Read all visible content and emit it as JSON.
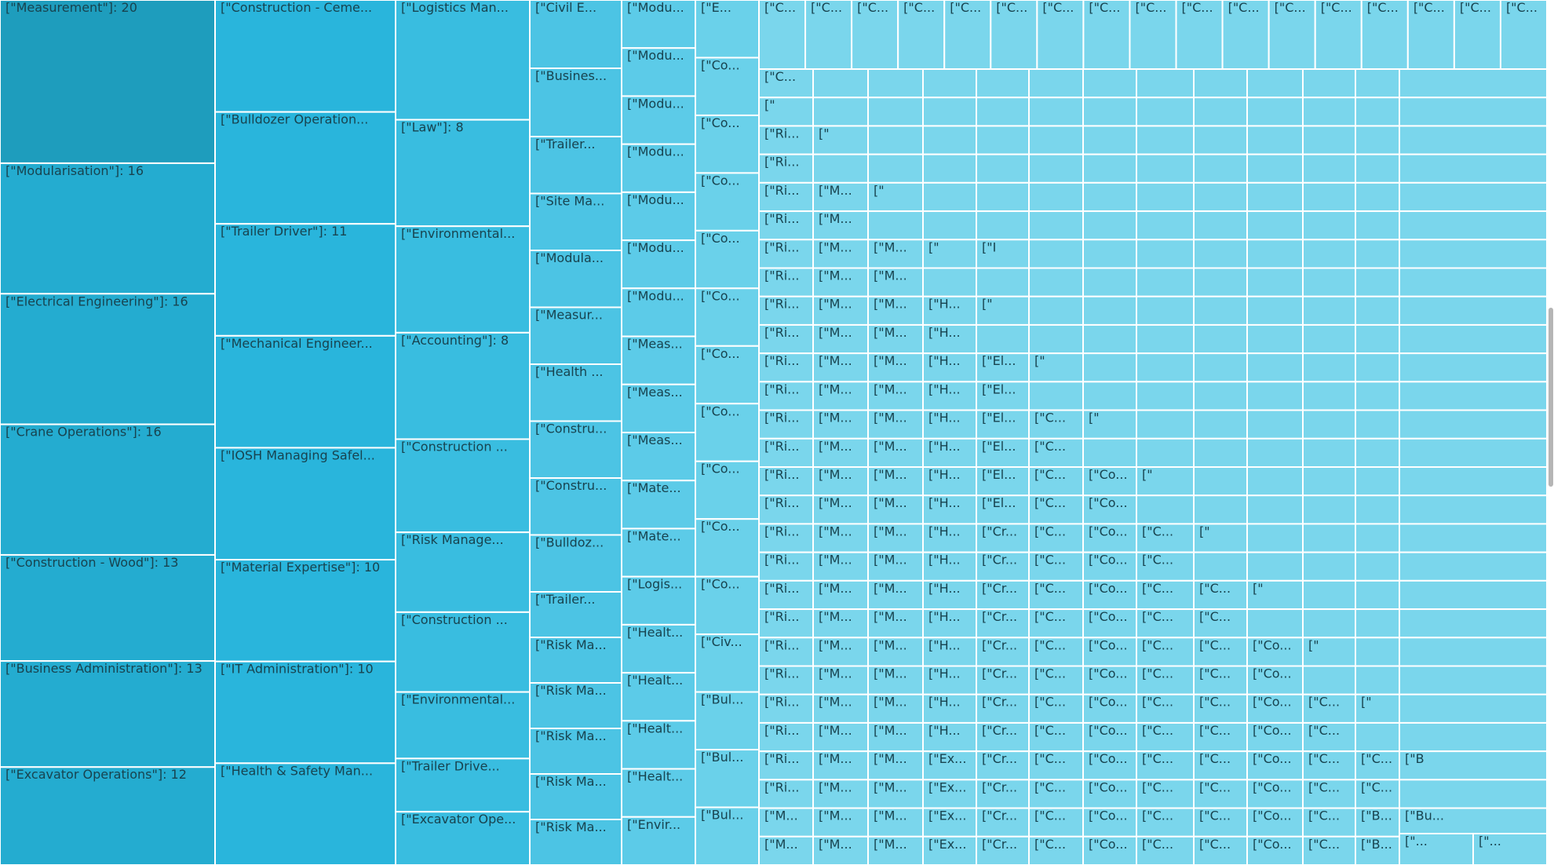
{
  "chart_data": {
    "type": "treemap",
    "colors": {
      "measurement": "#1e9dbd",
      "column0": "#24acd0",
      "column1": "#29b5dc",
      "column2": "#39bde0",
      "column3": "#4cc4e4",
      "column4": "#5ccbe8",
      "column5": "#6ad1ea",
      "rest": "#7ad6ec",
      "border": "#ffffff",
      "label": "#18434f"
    },
    "columns": [
      {
        "items": [
          {
            "label": "[\"Measurement\"]: 20",
            "value": 20
          },
          {
            "label": "[\"Modularisation\"]: 16",
            "value": 16
          },
          {
            "label": "[\"Electrical Engineering\"]: 16",
            "value": 16
          },
          {
            "label": "[\"Crane Operations\"]: 16",
            "value": 16
          },
          {
            "label": "[\"Construction - Wood\"]: 13",
            "value": 13
          },
          {
            "label": "[\"Business Administration\"]: 13",
            "value": 13
          },
          {
            "label": "[\"Excavator Operations\"]: 12",
            "value": 12
          }
        ]
      },
      {
        "items": [
          {
            "label": "[\"Construction - Ceme...",
            "value": 11
          },
          {
            "label": "[\"Bulldozer Operation...",
            "value": 11
          },
          {
            "label": "[\"Trailer Driver\"]: 11",
            "value": 11
          },
          {
            "label": "[\"Mechanical Engineer...",
            "value": 11
          },
          {
            "label": "[\"IOSH Managing Safel...",
            "value": 11
          },
          {
            "label": "[\"Material Expertise\"]: 10",
            "value": 10
          },
          {
            "label": "[\"IT Administration\"]: 10",
            "value": 10
          },
          {
            "label": "[\"Health & Safety Man...",
            "value": 10
          }
        ]
      },
      {
        "items": [
          {
            "label": "[\"Logistics Man...",
            "value": 9
          },
          {
            "label": "[\"Law\"]: 8",
            "value": 8
          },
          {
            "label": "[\"Environmental...",
            "value": 8
          },
          {
            "label": "[\"Accounting\"]: 8",
            "value": 8
          },
          {
            "label": "[\"Construction ...",
            "value": 7
          },
          {
            "label": "[\"Risk Manage...",
            "value": 6
          },
          {
            "label": "[\"Construction ...",
            "value": 6
          },
          {
            "label": "[\"Environmental...",
            "value": 5
          },
          {
            "label": "[\"Trailer Drive...",
            "value": 4
          },
          {
            "label": "[\"Excavator Ope...",
            "value": 4
          }
        ]
      },
      {
        "items": [
          {
            "label": "[\"Civil E...",
            "value": 6
          },
          {
            "label": "[\"Busines...",
            "value": 6
          },
          {
            "label": "[\"Trailer...",
            "value": 5
          },
          {
            "label": "[\"Site Ma...",
            "value": 5
          },
          {
            "label": "[\"Modula...",
            "value": 5
          },
          {
            "label": "[\"Measur...",
            "value": 5
          },
          {
            "label": "[\"Health ...",
            "value": 5
          },
          {
            "label": "[\"Constru...",
            "value": 5
          },
          {
            "label": "[\"Constru...",
            "value": 5
          },
          {
            "label": "[\"Bulldoz...",
            "value": 5
          },
          {
            "label": "[\"Trailer...",
            "value": 4
          },
          {
            "label": "[\"Risk Ma...",
            "value": 4
          },
          {
            "label": "[\"Risk Ma...",
            "value": 4
          },
          {
            "label": "[\"Risk Ma...",
            "value": 4
          },
          {
            "label": "[\"Risk Ma...",
            "value": 4
          },
          {
            "label": "[\"Risk Ma...",
            "value": 4
          }
        ]
      },
      {
        "items": [
          {
            "label": "[\"Modu...",
            "value": 4
          },
          {
            "label": "[\"Modu...",
            "value": 4
          },
          {
            "label": "[\"Modu...",
            "value": 4
          },
          {
            "label": "[\"Modu...",
            "value": 4
          },
          {
            "label": "[\"Modu...",
            "value": 4
          },
          {
            "label": "[\"Modu...",
            "value": 4
          },
          {
            "label": "[\"Modu...",
            "value": 4
          },
          {
            "label": "[\"Meas...",
            "value": 4
          },
          {
            "label": "[\"Meas...",
            "value": 4
          },
          {
            "label": "[\"Meas...",
            "value": 4
          },
          {
            "label": "[\"Mate...",
            "value": 4
          },
          {
            "label": "[\"Mate...",
            "value": 4
          },
          {
            "label": "[\"Logis...",
            "value": 4
          },
          {
            "label": "[\"Healt...",
            "value": 4
          },
          {
            "label": "[\"Healt...",
            "value": 4
          },
          {
            "label": "[\"Healt...",
            "value": 4
          },
          {
            "label": "[\"Healt...",
            "value": 4
          },
          {
            "label": "[\"Envir...",
            "value": 4
          }
        ]
      },
      {
        "items": [
          {
            "label": "[\"E...",
            "value": 3
          },
          {
            "label": "[\"Co...",
            "value": 3
          },
          {
            "label": "[\"Co...",
            "value": 3
          },
          {
            "label": "[\"Co...",
            "value": 3
          },
          {
            "label": "[\"Co...",
            "value": 3
          },
          {
            "label": "[\"Co...",
            "value": 3
          },
          {
            "label": "[\"Co...",
            "value": 3
          },
          {
            "label": "[\"Co...",
            "value": 3
          },
          {
            "label": "[\"Co...",
            "value": 3
          },
          {
            "label": "[\"Co...",
            "value": 3
          },
          {
            "label": "[\"Co...",
            "value": 3
          },
          {
            "label": "[\"Civ...",
            "value": 3
          },
          {
            "label": "[\"Bul...",
            "value": 3
          },
          {
            "label": "[\"Bul...",
            "value": 3
          },
          {
            "label": "[\"Bul...",
            "value": 3
          }
        ]
      }
    ],
    "rest_grid": {
      "rows": [
        {
          "texts": [
            "[\"C..."
          ]
        },
        {
          "texts": [
            "[\""
          ]
        },
        {
          "texts": [
            "[\"Ri...",
            "[\""
          ]
        },
        {
          "texts": [
            "[\"Ri..."
          ]
        },
        {
          "texts": [
            "[\"Ri...",
            "[\"M...",
            "[\""
          ]
        },
        {
          "texts": [
            "[\"Ri...",
            "[\"M..."
          ]
        },
        {
          "texts": [
            "[\"Ri...",
            "[\"M...",
            "[\"M...",
            "[\"",
            "[\"I"
          ]
        },
        {
          "texts": [
            "[\"Ri...",
            "[\"M...",
            "[\"M..."
          ]
        },
        {
          "texts": [
            "[\"Ri...",
            "[\"M...",
            "[\"M...",
            "[\"H...",
            "[\""
          ]
        },
        {
          "texts": [
            "[\"Ri...",
            "[\"M...",
            "[\"M...",
            "[\"H..."
          ]
        },
        {
          "texts": [
            "[\"Ri...",
            "[\"M...",
            "[\"M...",
            "[\"H...",
            "[\"El...",
            "[\""
          ]
        },
        {
          "texts": [
            "[\"Ri...",
            "[\"M...",
            "[\"M...",
            "[\"H...",
            "[\"El..."
          ]
        },
        {
          "texts": [
            "[\"Ri...",
            "[\"M...",
            "[\"M...",
            "[\"H...",
            "[\"El...",
            "[\"C...",
            "[\""
          ]
        },
        {
          "texts": [
            "[\"Ri...",
            "[\"M...",
            "[\"M...",
            "[\"H...",
            "[\"El...",
            "[\"C..."
          ]
        },
        {
          "texts": [
            "[\"Ri...",
            "[\"M...",
            "[\"M...",
            "[\"H...",
            "[\"El...",
            "[\"C...",
            "[\"Co...",
            "[\""
          ]
        },
        {
          "texts": [
            "[\"Ri...",
            "[\"M...",
            "[\"M...",
            "[\"H...",
            "[\"El...",
            "[\"C...",
            "[\"Co..."
          ]
        },
        {
          "texts": [
            "[\"Ri...",
            "[\"M...",
            "[\"M...",
            "[\"H...",
            "[\"Cr...",
            "[\"C...",
            "[\"Co...",
            "[\"C...",
            "[\""
          ]
        },
        {
          "texts": [
            "[\"Ri...",
            "[\"M...",
            "[\"M...",
            "[\"H...",
            "[\"Cr...",
            "[\"C...",
            "[\"Co...",
            "[\"C..."
          ]
        },
        {
          "texts": [
            "[\"Ri...",
            "[\"M...",
            "[\"M...",
            "[\"H...",
            "[\"Cr...",
            "[\"C...",
            "[\"Co...",
            "[\"C...",
            "[\"C...",
            "[\""
          ]
        },
        {
          "texts": [
            "[\"Ri...",
            "[\"M...",
            "[\"M...",
            "[\"H...",
            "[\"Cr...",
            "[\"C...",
            "[\"Co...",
            "[\"C...",
            "[\"C..."
          ]
        },
        {
          "texts": [
            "[\"Ri...",
            "[\"M...",
            "[\"M...",
            "[\"H...",
            "[\"Cr...",
            "[\"C...",
            "[\"Co...",
            "[\"C...",
            "[\"C...",
            "[\"Co...",
            "[\""
          ]
        },
        {
          "texts": [
            "[\"Ri...",
            "[\"M...",
            "[\"M...",
            "[\"H...",
            "[\"Cr...",
            "[\"C...",
            "[\"Co...",
            "[\"C...",
            "[\"C...",
            "[\"Co..."
          ]
        },
        {
          "texts": [
            "[\"Ri...",
            "[\"M...",
            "[\"M...",
            "[\"H...",
            "[\"Cr...",
            "[\"C...",
            "[\"Co...",
            "[\"C...",
            "[\"C...",
            "[\"Co...",
            "[\"C...",
            "[\""
          ]
        },
        {
          "texts": [
            "[\"Ri...",
            "[\"M...",
            "[\"M...",
            "[\"H...",
            "[\"Cr...",
            "[\"C...",
            "[\"Co...",
            "[\"C...",
            "[\"C...",
            "[\"Co...",
            "[\"C..."
          ]
        },
        {
          "texts": [
            "[\"Ri...",
            "[\"M...",
            "[\"M...",
            "[\"Ex...",
            "[\"Cr...",
            "[\"C...",
            "[\"Co...",
            "[\"C...",
            "[\"C...",
            "[\"Co...",
            "[\"C...",
            "[\"C...",
            "[\"B"
          ]
        },
        {
          "texts": [
            "[\"Ri...",
            "[\"M...",
            "[\"M...",
            "[\"Ex...",
            "[\"Cr...",
            "[\"C...",
            "[\"Co...",
            "[\"C...",
            "[\"C...",
            "[\"Co...",
            "[\"C...",
            "[\"C..."
          ]
        },
        {
          "texts": [
            "[\"M...",
            "[\"M...",
            "[\"M...",
            "[\"Ex...",
            "[\"Cr...",
            "[\"C...",
            "[\"Co...",
            "[\"C...",
            "[\"C...",
            "[\"Co...",
            "[\"C...",
            "[\"B...",
            "[\"Bu...",
            "[\""
          ]
        },
        {
          "texts": [
            "[\"M...",
            "[\"M...",
            "[\"M...",
            "[\"Ex...",
            "[\"Cr...",
            "[\"C...",
            "[\"Co...",
            "[\"C...",
            "[\"C...",
            "[\"Co...",
            "[\"C...",
            "[\"B...",
            "[\"Bu..."
          ]
        }
      ],
      "top_row_labels": [
        "[\"C...",
        "[\"C...",
        "[\"C...",
        "[\"C...",
        "[\"C...",
        "[\"C...",
        "[\"C...",
        "[\"C...",
        "[\"C...",
        "[\"C...",
        "[\"C...",
        "[\"C...",
        "[\"C...",
        "[\"C...",
        "[\"C...",
        "[\"C...",
        "[\"C..."
      ],
      "bottom_tail_labels": [
        "[\"...",
        "[\"..."
      ],
      "i_labels": [
        "[\"I",
        "[\"I",
        "[\"I",
        "[\"I",
        "[\"I"
      ],
      "b_labels": [
        "[\"B",
        "[\"B",
        "[\"B"
      ]
    }
  }
}
